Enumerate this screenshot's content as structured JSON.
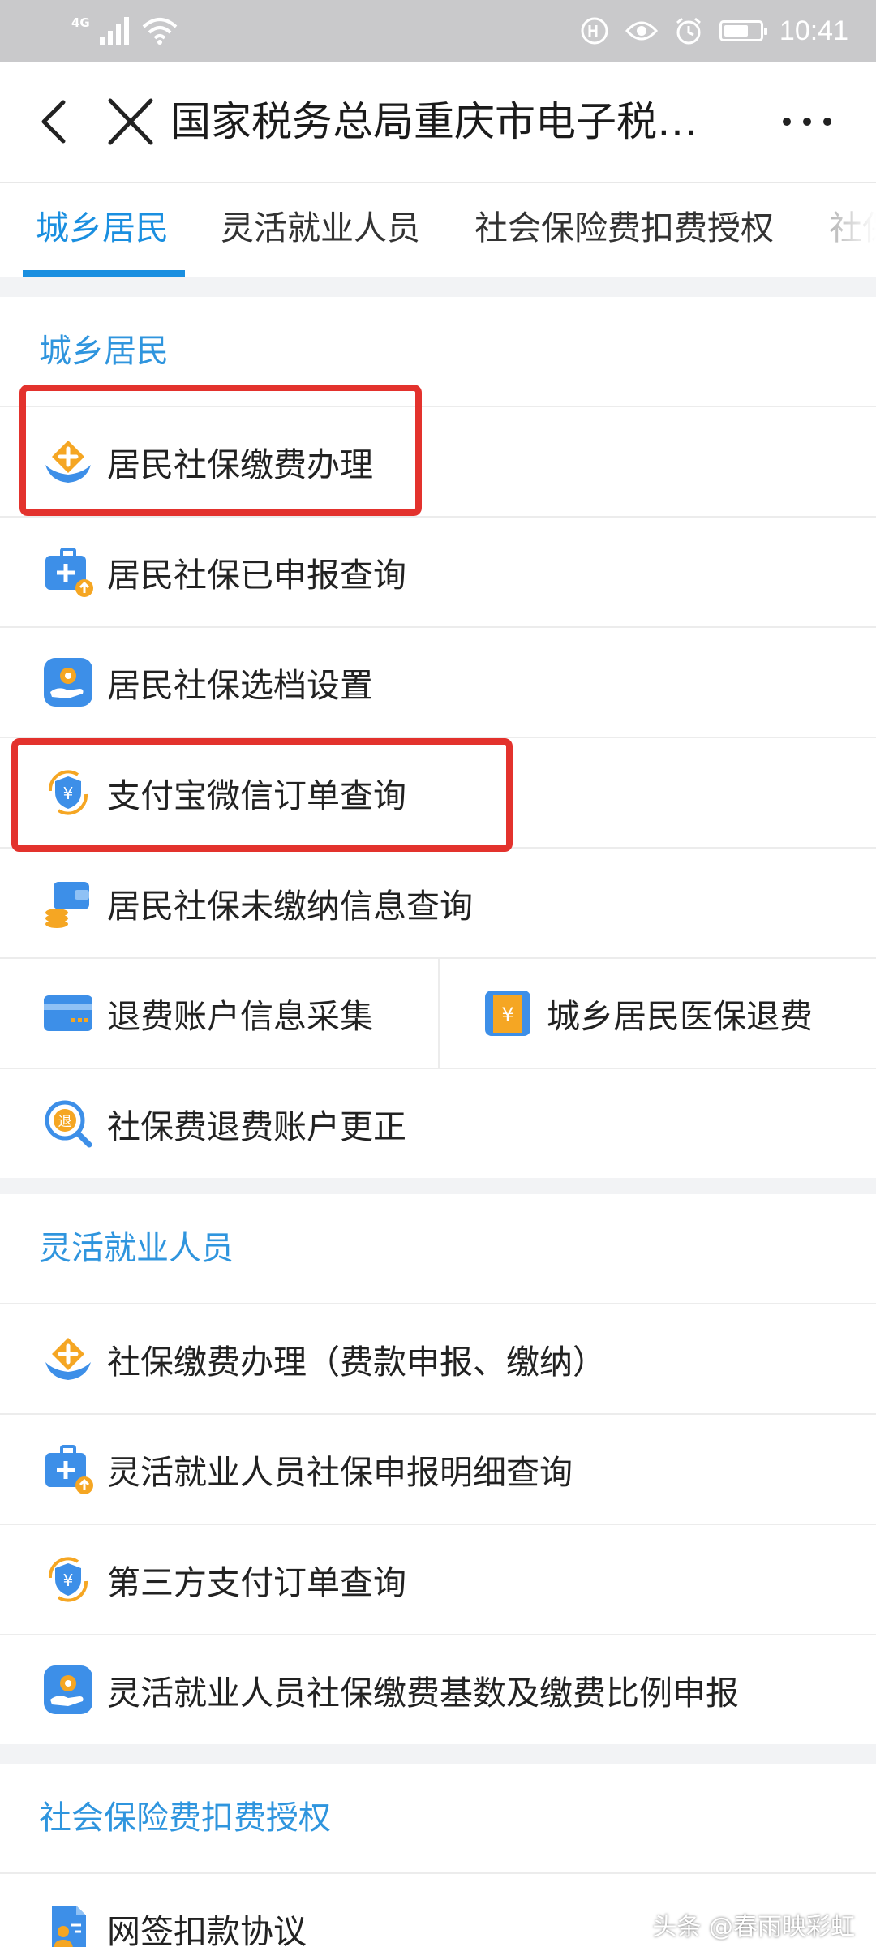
{
  "status_bar": {
    "network": "4G",
    "time": "10:41"
  },
  "header": {
    "title": "国家税务总局重庆市电子税…"
  },
  "tabs": [
    {
      "label": "城乡居民",
      "active": true
    },
    {
      "label": "灵活就业人员"
    },
    {
      "label": "社会保险费扣费授权"
    },
    {
      "label": "社保"
    }
  ],
  "sections": {
    "urban_rural": {
      "title": "城乡居民",
      "items": [
        {
          "label": "居民社保缴费办理",
          "icon": "hand-plus-icon"
        },
        {
          "label": "居民社保已申报查询",
          "icon": "medical-kit-icon"
        },
        {
          "label": "居民社保选档设置",
          "icon": "hand-gear-icon"
        },
        {
          "label": "支付宝微信订单查询",
          "icon": "yuan-shield-icon"
        },
        {
          "label": "居民社保未缴纳信息查询",
          "icon": "wallet-coins-icon"
        },
        {
          "label": "退费账户信息采集",
          "icon": "bank-card-icon"
        },
        {
          "label": "城乡居民医保退费",
          "icon": "yuan-receipt-icon"
        },
        {
          "label": "社保费退费账户更正",
          "icon": "refund-search-icon"
        }
      ]
    },
    "flexible": {
      "title": "灵活就业人员",
      "items": [
        {
          "label": "社保缴费办理（费款申报、缴纳）",
          "icon": "hand-plus-icon"
        },
        {
          "label": "灵活就业人员社保申报明细查询",
          "icon": "medical-kit-icon"
        },
        {
          "label": "第三方支付订单查询",
          "icon": "yuan-shield-icon"
        },
        {
          "label": "灵活就业人员社保缴费基数及缴费比例申报",
          "icon": "hand-gear-icon"
        }
      ]
    },
    "authorization": {
      "title": "社会保险费扣费授权",
      "items": [
        {
          "label": "网签扣款协议",
          "icon": "contract-user-icon"
        }
      ]
    }
  },
  "watermark": "头条 @春雨映彩虹",
  "colors": {
    "accent": "#1a8fe0",
    "highlight": "#e3322d",
    "icon_orange": "#f5a623",
    "icon_blue": "#3d8fe8"
  }
}
